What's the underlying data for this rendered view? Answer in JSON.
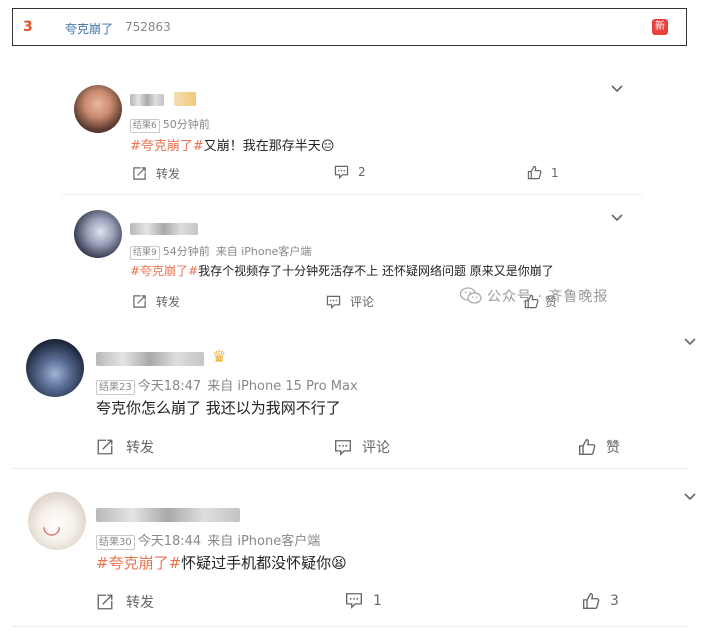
{
  "trending": {
    "rank": "3",
    "topic": "夸克崩了",
    "count": "752863",
    "badge": "新"
  },
  "watermark": {
    "text": "公众号 · 齐鲁晚报"
  },
  "comments": [
    {
      "level": "结果6",
      "time": "50分钟前",
      "source": "",
      "hashtag": "#夸克崩了#",
      "text": "又崩！我在那存半天",
      "emoji": "😑",
      "repost_label": "转发",
      "comment_count": "2",
      "like_count": "1"
    },
    {
      "level": "结果9",
      "time": "54分钟前",
      "source": "来自 iPhone客户端",
      "hashtag": "#夸克崩了#",
      "text": "我存个视频存了十分钟死活存不上 还怀疑网络问题 原来又是你崩了",
      "repost_label": "转发",
      "comment_label": "评论",
      "like_label": "赞"
    },
    {
      "level": "结果23",
      "time": "今天18:47",
      "source": "来自 iPhone 15 Pro Max",
      "text": "夸克你怎么崩了 我还以为我网不行了",
      "repost_label": "转发",
      "comment_label": "评论",
      "like_label": "赞"
    },
    {
      "level": "结果30",
      "time": "今天18:44",
      "source": "来自 iPhone客户端",
      "hashtag": "#夸克崩了#",
      "text": "怀疑过手机都没怀疑你",
      "emoji": "😫",
      "repost_label": "转发",
      "comment_count": "1",
      "like_count": "3"
    }
  ]
}
